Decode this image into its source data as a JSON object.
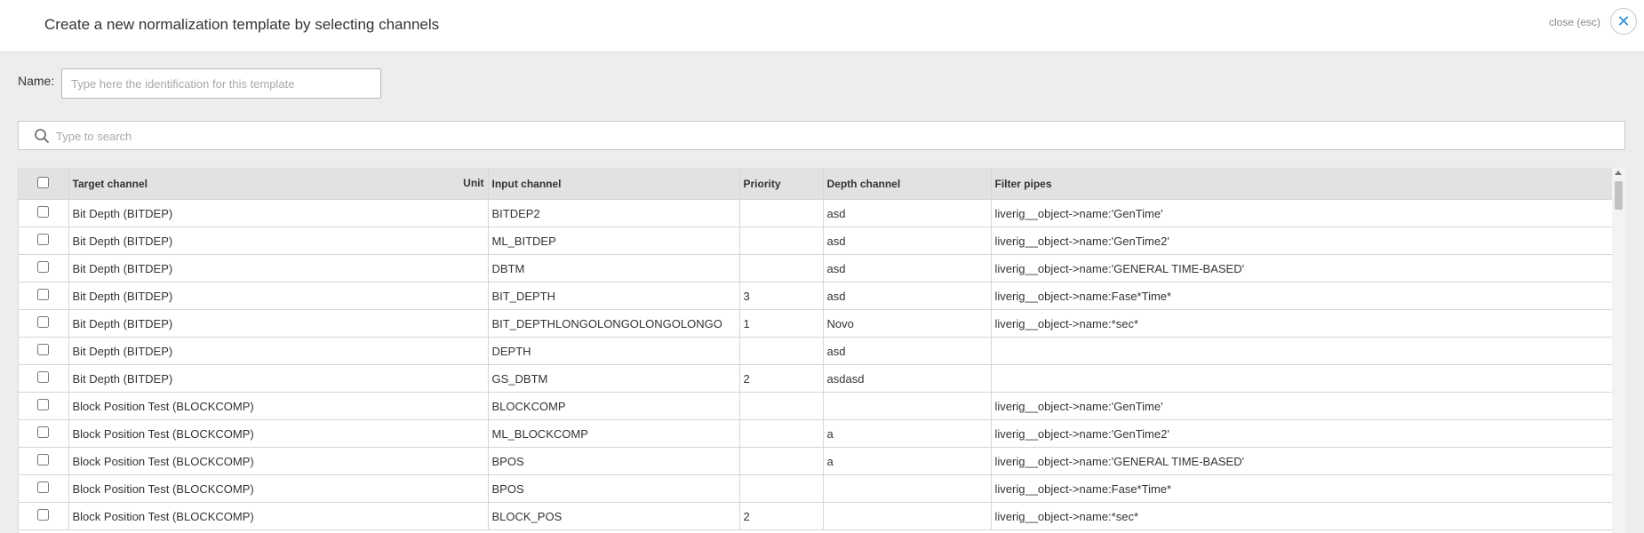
{
  "header": {
    "title": "Create a new normalization template by selecting channels",
    "close_label": "close (esc)",
    "close_icon": "close-icon",
    "accent_color": "#2c8fd6"
  },
  "form": {
    "name_label": "Name:",
    "name_value": "",
    "name_placeholder": "Type here the identification for this template"
  },
  "search": {
    "icon": "search-icon",
    "value": "",
    "placeholder": "Type to search"
  },
  "table": {
    "columns": {
      "target": "Target channel",
      "unit": "Unit",
      "input": "Input channel",
      "priority": "Priority",
      "depth": "Depth channel",
      "filter": "Filter pipes"
    },
    "rows": [
      {
        "target": "Bit Depth (BITDEP)",
        "unit": "",
        "input": "BITDEP2",
        "priority": "",
        "depth": "asd",
        "filter": "liverig__object->name:'GenTime'",
        "checked": false
      },
      {
        "target": "Bit Depth (BITDEP)",
        "unit": "",
        "input": "ML_BITDEP",
        "priority": "",
        "depth": "asd",
        "filter": "liverig__object->name:'GenTime2'",
        "checked": false
      },
      {
        "target": "Bit Depth (BITDEP)",
        "unit": "",
        "input": "DBTM",
        "priority": "",
        "depth": "asd",
        "filter": "liverig__object->name:'GENERAL TIME-BASED'",
        "checked": false
      },
      {
        "target": "Bit Depth (BITDEP)",
        "unit": "",
        "input": "BIT_DEPTH",
        "priority": "3",
        "depth": "asd",
        "filter": "liverig__object->name:Fase*Time*",
        "checked": false
      },
      {
        "target": "Bit Depth (BITDEP)",
        "unit": "",
        "input": "BIT_DEPTHLONGOLONGOLONGOLONGO",
        "priority": "1",
        "depth": "Novo",
        "filter": "liverig__object->name:*sec*",
        "checked": false
      },
      {
        "target": "Bit Depth (BITDEP)",
        "unit": "",
        "input": "DEPTH",
        "priority": "",
        "depth": "asd",
        "filter": "",
        "checked": false
      },
      {
        "target": "Bit Depth (BITDEP)",
        "unit": "",
        "input": "GS_DBTM",
        "priority": "2",
        "depth": "asdasd",
        "filter": "",
        "checked": false
      },
      {
        "target": "Block Position Test (BLOCKCOMP)",
        "unit": "",
        "input": "BLOCKCOMP",
        "priority": "",
        "depth": "",
        "filter": "liverig__object->name:'GenTime'",
        "checked": false
      },
      {
        "target": "Block Position Test (BLOCKCOMP)",
        "unit": "",
        "input": "ML_BLOCKCOMP",
        "priority": "",
        "depth": "a",
        "filter": "liverig__object->name:'GenTime2'",
        "checked": false
      },
      {
        "target": "Block Position Test (BLOCKCOMP)",
        "unit": "",
        "input": "BPOS",
        "priority": "",
        "depth": "a",
        "filter": "liverig__object->name:'GENERAL TIME-BASED'",
        "checked": false
      },
      {
        "target": "Block Position Test (BLOCKCOMP)",
        "unit": "",
        "input": "BPOS",
        "priority": "",
        "depth": "",
        "filter": "liverig__object->name:Fase*Time*",
        "checked": false
      },
      {
        "target": "Block Position Test (BLOCKCOMP)",
        "unit": "",
        "input": "BLOCK_POS",
        "priority": "2",
        "depth": "",
        "filter": "liverig__object->name:*sec*",
        "checked": false
      }
    ]
  }
}
